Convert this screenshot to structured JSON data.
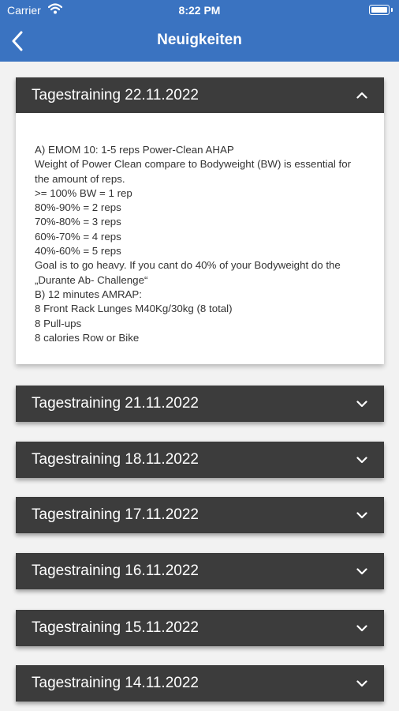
{
  "status_bar": {
    "carrier": "Carrier",
    "time": "8:22 PM"
  },
  "nav": {
    "title": "Neuigkeiten"
  },
  "expanded": {
    "title": "Tagestraining 22.11.2022",
    "body": "A) EMOM 10: 1-5 reps Power-Clean AHAP\nWeight of Power Clean compare to Bodyweight (BW) is essential for the amount of reps.\n>= 100% BW = 1 rep\n80%-90% = 2 reps\n70%-80% = 3 reps\n60%-70% = 4 reps\n40%-60% = 5 reps\nGoal is to go heavy. If you cant do 40% of your Bodyweight do the „Durante Ab- Challenge“\nB) 12 minutes AMRAP:\n8 Front Rack Lunges M40Kg/30kg (8 total)\n8 Pull-ups\n8 calories Row or Bike"
  },
  "items": [
    {
      "title": "Tagestraining 21.11.2022"
    },
    {
      "title": "Tagestraining 18.11.2022"
    },
    {
      "title": "Tagestraining 17.11.2022"
    },
    {
      "title": "Tagestraining 16.11.2022"
    },
    {
      "title": "Tagestraining 15.11.2022"
    },
    {
      "title": "Tagestraining 14.11.2022"
    }
  ]
}
